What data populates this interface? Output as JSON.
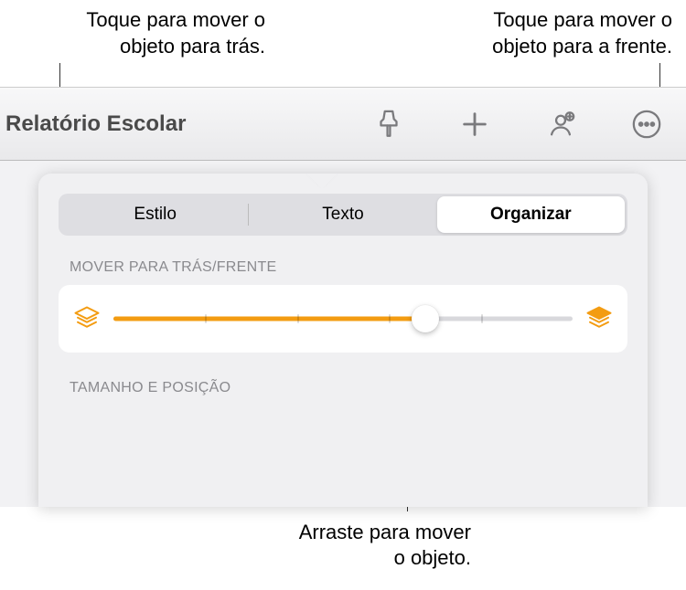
{
  "callouts": {
    "back": "Toque para mover o objeto para trás.",
    "front": "Toque para mover o objeto para a frente.",
    "drag": "Arraste para mover o objeto."
  },
  "toolbar": {
    "title": "Relatório Escolar"
  },
  "tabs": {
    "style": "Estilo",
    "text": "Texto",
    "arrange": "Organizar"
  },
  "sections": {
    "moveBackFront": "MOVER PARA TRÁS/FRENTE",
    "sizePosition": "TAMANHO E POSIÇÃO"
  }
}
